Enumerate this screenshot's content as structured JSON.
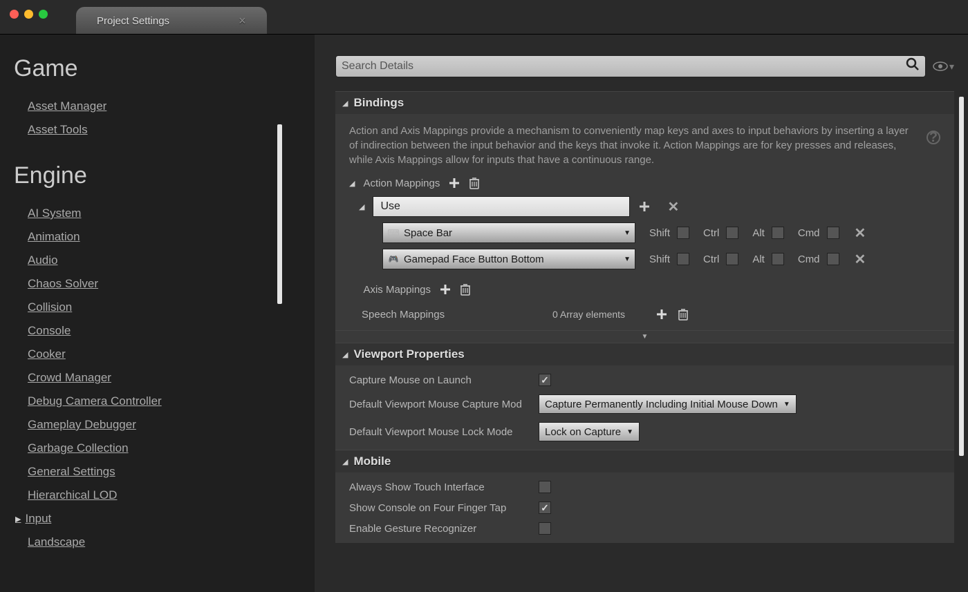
{
  "window": {
    "tab_title": "Project Settings"
  },
  "search": {
    "placeholder": "Search Details"
  },
  "sidebar": {
    "categories": [
      {
        "title": "Game",
        "items": [
          "Asset Manager",
          "Asset Tools"
        ]
      },
      {
        "title": "Engine",
        "items": [
          "AI System",
          "Animation",
          "Audio",
          "Chaos Solver",
          "Collision",
          "Console",
          "Cooker",
          "Crowd Manager",
          "Debug Camera Controller",
          "Gameplay Debugger",
          "Garbage Collection",
          "General Settings",
          "Hierarchical LOD",
          "Input",
          "Landscape"
        ]
      }
    ],
    "selected_item": "Input"
  },
  "bindings": {
    "title": "Bindings",
    "description": "Action and Axis Mappings provide a mechanism to conveniently map keys and axes to input behaviors by inserting a layer of indirection between the input behavior and the keys that invoke it. Action Mappings are for key presses and releases, while Axis Mappings allow for inputs that have a continuous range.",
    "action_mappings_label": "Action Mappings",
    "axis_mappings_label": "Axis Mappings",
    "speech_mappings_label": "Speech Mappings",
    "speech_mappings_value": "0 Array elements",
    "action": {
      "name": "Use",
      "keys": [
        {
          "icon": "keyboard",
          "label": "Space Bar",
          "mods": {
            "shift": false,
            "ctrl": false,
            "alt": false,
            "cmd": false
          }
        },
        {
          "icon": "gamepad",
          "label": "Gamepad Face Button Bottom",
          "mods": {
            "shift": false,
            "ctrl": false,
            "alt": false,
            "cmd": false
          }
        }
      ]
    },
    "modifiers": {
      "shift": "Shift",
      "ctrl": "Ctrl",
      "alt": "Alt",
      "cmd": "Cmd"
    }
  },
  "viewport": {
    "title": "Viewport Properties",
    "rows": {
      "capture_on_launch": {
        "label": "Capture Mouse on Launch",
        "checked": true
      },
      "capture_mode": {
        "label": "Default Viewport Mouse Capture Mod",
        "value": "Capture Permanently Including Initial Mouse Down"
      },
      "lock_mode": {
        "label": "Default Viewport Mouse Lock Mode",
        "value": "Lock on Capture"
      }
    }
  },
  "mobile": {
    "title": "Mobile",
    "rows": {
      "touch_interface": {
        "label": "Always Show Touch Interface",
        "checked": false
      },
      "console_tap": {
        "label": "Show Console on Four Finger Tap",
        "checked": true
      },
      "gesture": {
        "label": "Enable Gesture Recognizer",
        "checked": false
      }
    }
  }
}
